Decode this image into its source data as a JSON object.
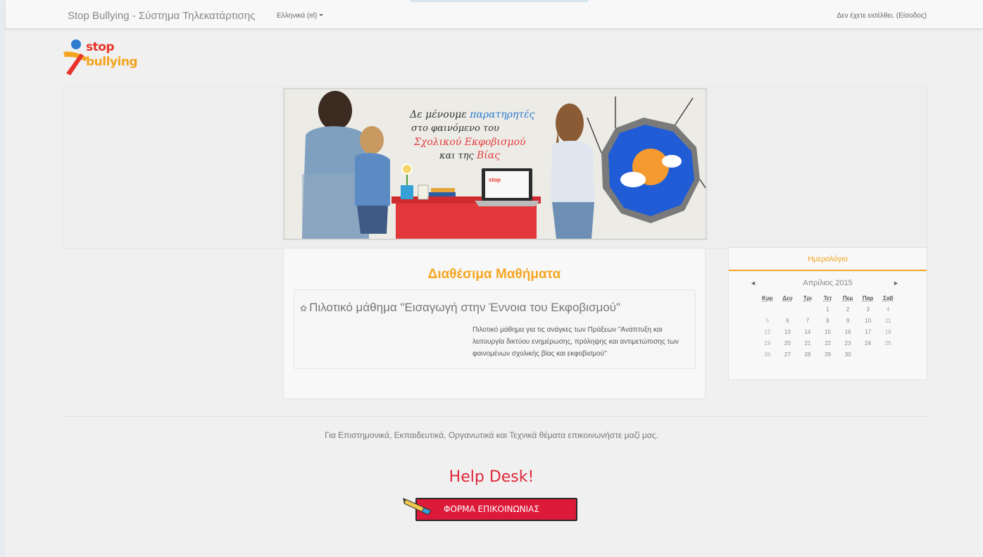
{
  "navbar": {
    "brand": "Stop Bullying - Σύστημα Τηλεκατάρτισης",
    "language": "Ελληνικά (el)",
    "login_prefix": "Δεν έχετε εισέλθει. (",
    "login_link": "Είσοδος",
    "login_suffix": ")"
  },
  "logo": {
    "line1": "stop",
    "line2": "bullying"
  },
  "banner": {
    "line1_a": "Δε μένουμε ",
    "line1_b": "παρατηρητές",
    "line2": "στο φαινόμενο του",
    "line3": "Σχολικού Εκφοβισμού",
    "line4_a": "και της ",
    "line4_b": "Βίας"
  },
  "courses": {
    "title": "Διαθέσιμα Μαθήματα",
    "items": [
      {
        "name": "Πιλοτικό μάθημα \"Εισαγωγή στην Έννοια του Εκφοβισμού\"",
        "summary": "Πιλοτικό μάθημα για τις ανάγκες των Πράξεων \"Ανάπτυξη και λειτουργία δικτύου ενημέρωσης, πρόληψης και αντιμετώπισης των φαινομένων σχολικής βίας και εκφοβισμού\""
      }
    ]
  },
  "calendar": {
    "title": "Ημερολόγιο",
    "month": "Απρίλιος 2015",
    "prev": "◄",
    "next": "►",
    "weekdays": [
      "Κυρ",
      "Δευ",
      "Τρι",
      "Τετ",
      "Πεμ",
      "Παρ",
      "Σαβ"
    ],
    "weeks": [
      [
        "",
        "",
        "",
        "1",
        "2",
        "3",
        "4"
      ],
      [
        "5",
        "6",
        "7",
        "8",
        "9",
        "10",
        "11"
      ],
      [
        "12",
        "13",
        "14",
        "15",
        "16",
        "17",
        "18"
      ],
      [
        "19",
        "20",
        "21",
        "22",
        "23",
        "24",
        "25"
      ],
      [
        "26",
        "27",
        "28",
        "29",
        "30",
        "",
        ""
      ]
    ]
  },
  "footer": {
    "contact_text": "Για Επιστημονικά, Εκπαιδευτικά, Οργανωτικά και Τεχνικά θέματα επικοινωνήστε μαζί μας.",
    "helpdesk": "Help Desk!",
    "form_button": "ΦΟΡΜΑ ΕΠΙΚΟΙΝΩΝΙΑΣ"
  },
  "colors": {
    "accent": "#f5a623",
    "helpdesk_red": "#e0283a",
    "button_red": "#dd1a3a"
  }
}
